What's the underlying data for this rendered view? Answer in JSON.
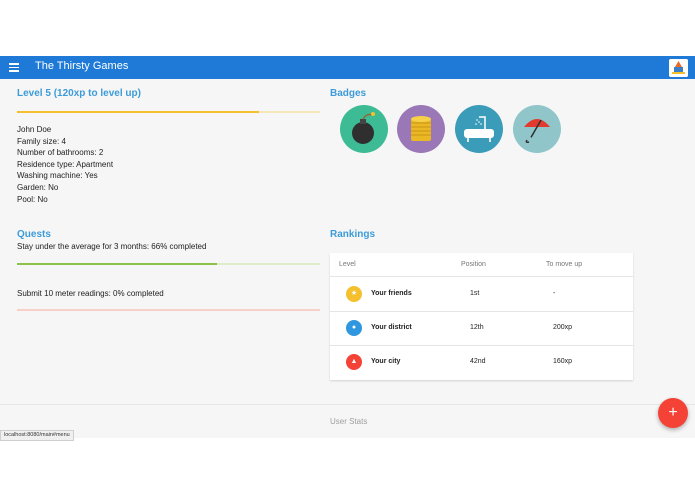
{
  "appbar": {
    "title": "The Thirsty Games",
    "color": "#1e7ad6"
  },
  "level": {
    "title": "Level 5 (120xp to level up)",
    "progress": 0.8
  },
  "profile": {
    "lines": [
      "John Doe",
      "Family size: 4",
      "Number of bathrooms: 2",
      "Residence type: Apartment",
      "Washing machine: Yes",
      "Garden: No",
      "Pool: No"
    ]
  },
  "badges": {
    "title": "Badges",
    "items": [
      {
        "icon": "bomb-icon",
        "color": "#3dbb94"
      },
      {
        "icon": "coins-icon",
        "color": "#9a77b7"
      },
      {
        "icon": "bathtub-icon",
        "color": "#3a9cb8"
      },
      {
        "icon": "umbrella-icon",
        "color": "#90c5c9"
      }
    ]
  },
  "quests": {
    "title": "Quests",
    "items": [
      {
        "text": "Stay under the average for 3 months: 66% completed",
        "progress": 0.66,
        "color": "#8bc34a",
        "track": "#dcedc8"
      },
      {
        "text": "Submit 10 meter readings: 0% completed",
        "progress": 0.0,
        "color": "#f44336",
        "track": "#f8cfc9"
      }
    ]
  },
  "rankings": {
    "title": "Rankings",
    "headers": {
      "level": "Level",
      "position": "Position",
      "move": "To move up"
    },
    "rows": [
      {
        "level": "Your friends",
        "position": "1st",
        "move": "-",
        "color": "#f5c02d",
        "icon": "star-icon"
      },
      {
        "level": "Your district",
        "position": "12th",
        "move": "200xp",
        "color": "#2f97e0",
        "icon": "droplet-icon"
      },
      {
        "level": "Your city",
        "position": "42nd",
        "move": "160xp",
        "color": "#f44336",
        "icon": "triangle-icon"
      }
    ]
  },
  "user_stats": "User Stats",
  "fab": {
    "label": "+"
  },
  "status_bar": "localhost:8080/main#menu"
}
